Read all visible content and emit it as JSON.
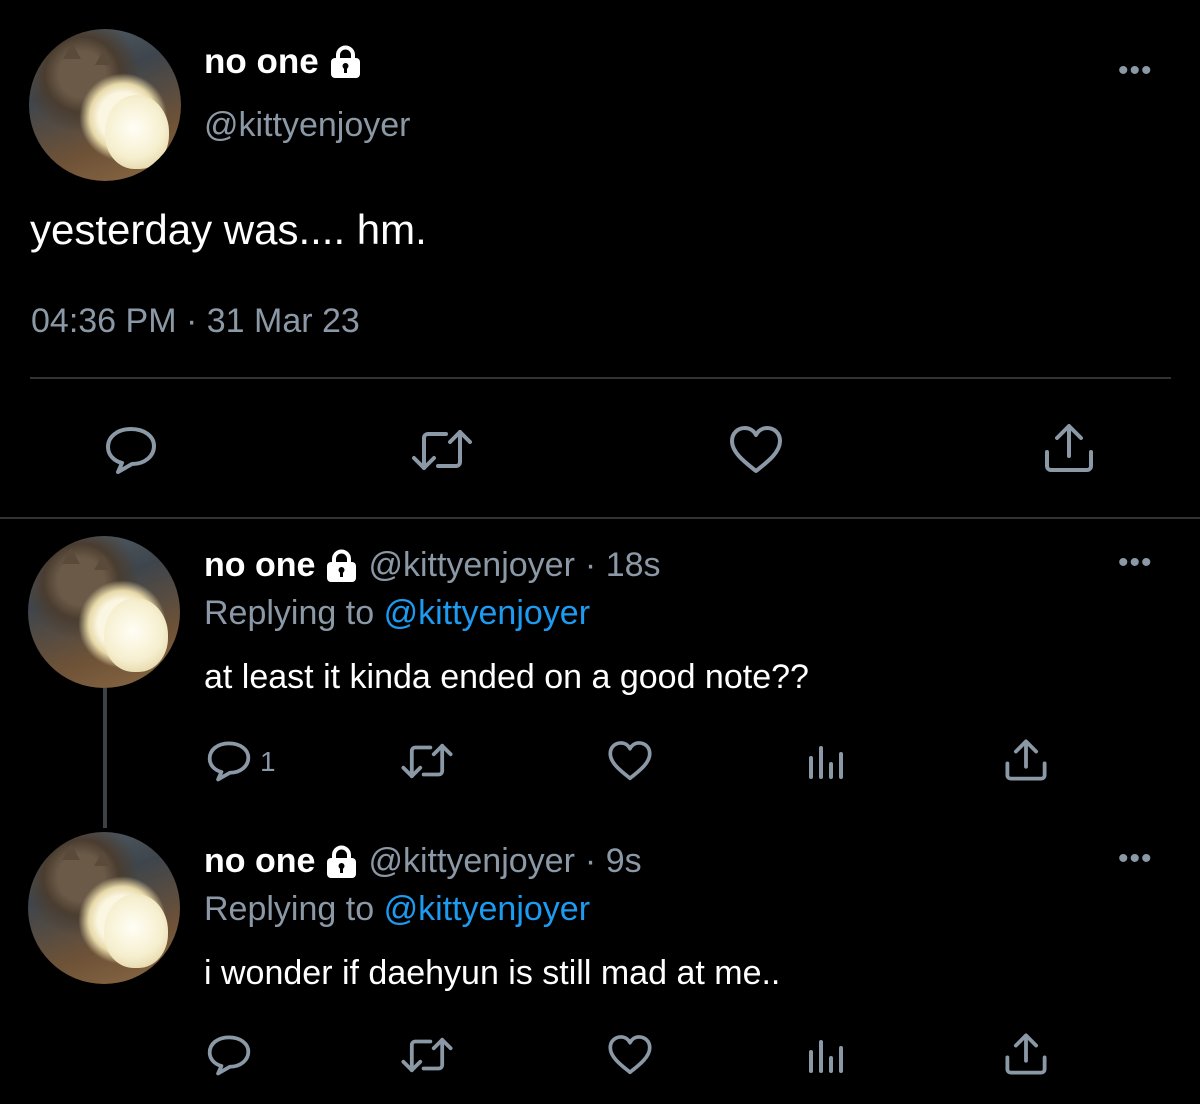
{
  "main_tweet": {
    "display_name": "no one",
    "handle": "@kittyenjoyer",
    "text": "yesterday was.... hm.",
    "timestamp": "04:36 PM · 31 Mar 23",
    "more_label": "•••",
    "actions": [
      "reply-icon",
      "retweet-icon",
      "like-icon",
      "share-icon"
    ]
  },
  "replies": [
    {
      "display_name": "no one",
      "handle": "@kittyenjoyer",
      "age": "· 18s",
      "replying_prefix": "Replying to",
      "replying_to": "@kittyenjoyer",
      "text": "at least it kinda ended on a good note??",
      "reply_count": "1",
      "more_label": "•••"
    },
    {
      "display_name": "no one",
      "handle": "@kittyenjoyer",
      "age": "· 9s",
      "replying_prefix": "Replying to",
      "replying_to": "@kittyenjoyer",
      "text": "i wonder if daehyun is still mad at me..",
      "reply_count": "",
      "more_label": "•••"
    }
  ],
  "colors": {
    "background": "#000000",
    "text": "#ffffff",
    "muted": "#8b98a5",
    "link": "#1d9bf0",
    "divider": "#2f3336"
  }
}
